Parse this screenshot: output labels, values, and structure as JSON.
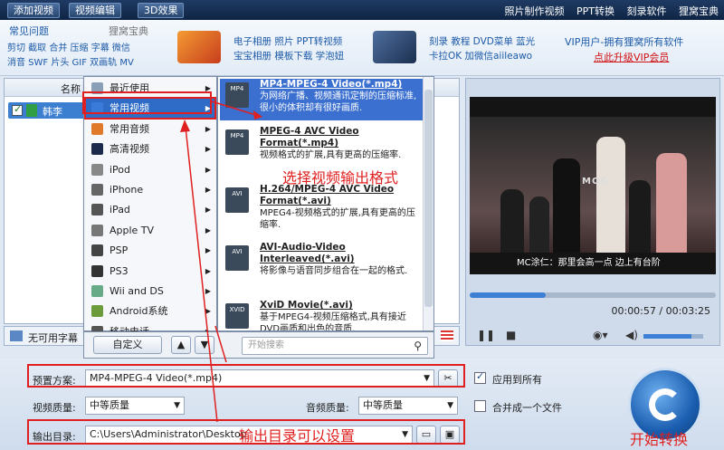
{
  "topbar": {
    "tabs": [
      "添加视频",
      "视频编辑",
      "3D效果"
    ],
    "links": [
      "照片制作视频",
      "PPT转换",
      "刻录软件",
      "狸窝宝典"
    ]
  },
  "faq": {
    "title": "常见问题",
    "search": "狸窝宝典",
    "line1": "剪切 截取 合并 压缩 字幕 微信",
    "line2": "消音 SWF 片头 GIF 双画轨 MV"
  },
  "ads": {
    "ad1_line1": "电子相册 照片 PPT转视频",
    "ad1_line2": "宝宝相册 模板下载 学泡妞",
    "ad2_line1": "刻录 教程 DVD菜单 蓝光",
    "ad2_line2": "卡拉OK 加微信aiileawo",
    "vip_line1": "VIP用户-拥有狸窝所有软件",
    "vip_line2": "点此升级VIP会员"
  },
  "filelist": {
    "column_name": "名称",
    "file_name": "韩李"
  },
  "subtitle_bar": {
    "label": "无可用字幕"
  },
  "menu": {
    "items": [
      {
        "label": "最近使用",
        "icon": "clock-icon"
      },
      {
        "label": "常用视频",
        "icon": "video-icon"
      },
      {
        "label": "常用音频",
        "icon": "audio-icon"
      },
      {
        "label": "高清视频",
        "icon": "hd-icon"
      },
      {
        "label": "iPod",
        "icon": "ipod-icon"
      },
      {
        "label": "iPhone",
        "icon": "iphone-icon"
      },
      {
        "label": "iPad",
        "icon": "ipad-icon"
      },
      {
        "label": "Apple TV",
        "icon": "appletv-icon"
      },
      {
        "label": "PSP",
        "icon": "psp-icon"
      },
      {
        "label": "PS3",
        "icon": "ps3-icon"
      },
      {
        "label": "Wii and DS",
        "icon": "wii-icon"
      },
      {
        "label": "Android系统",
        "icon": "android-icon"
      },
      {
        "label": "移动电话",
        "icon": "phone-icon"
      }
    ],
    "selected_index": 1,
    "custom_button": "自定义",
    "search_placeholder": "开始搜索"
  },
  "formats": [
    {
      "title": "MP4-MPEG-4 Video(*.mp4)",
      "desc": "为网络广播、视频通讯定制的压缩标准,很小的体积却有很好画质.",
      "icon_text": "MP4"
    },
    {
      "title": "MPEG-4 AVC Video Format(*.mp4)",
      "desc": "视频格式的扩展,具有更高的压缩率.",
      "icon_text": "MP4"
    },
    {
      "title": "H.264/MPEG-4 AVC Video Format(*.avi)",
      "desc": "MPEG4-视频格式的扩展,具有更高的压缩率.",
      "icon_text": "AVI"
    },
    {
      "title": "AVI-Audio-Video Interleaved(*.avi)",
      "desc": "将影像与语音同步组合在一起的格式.",
      "icon_text": "AVI"
    },
    {
      "title": "XviD Movie(*.avi)",
      "desc": "基于MPEG4-视频压缩格式,具有接近DVD画质和出色的音质.",
      "icon_text": "XVID"
    }
  ],
  "preview": {
    "moc": "MOC",
    "caption": "MC涂仁：那里会高一点 边上有台阶",
    "time": "00:00:57 / 00:03:25",
    "progress": 0.31,
    "volume": 0.8
  },
  "settings": {
    "preset_label": "预置方案:",
    "preset_value": "MP4-MPEG-4 Video(*.mp4)",
    "apply_all": "应用到所有",
    "video_quality_label": "视频质量:",
    "video_quality_value": "中等质量",
    "audio_quality_label": "音频质量:",
    "audio_quality_value": "中等质量",
    "merge_label": "合并成一个文件",
    "output_label": "输出目录:",
    "output_value": "C:\\Users\\Administrator\\Desktop"
  },
  "annotations": {
    "format_note": "选择视频输出格式",
    "output_note": "输出目录可以设置",
    "convert_note": "开始转换"
  },
  "colors": {
    "accent": "#2e6cc8",
    "annotation": "#e02020",
    "topbar": "#1f3b63"
  }
}
